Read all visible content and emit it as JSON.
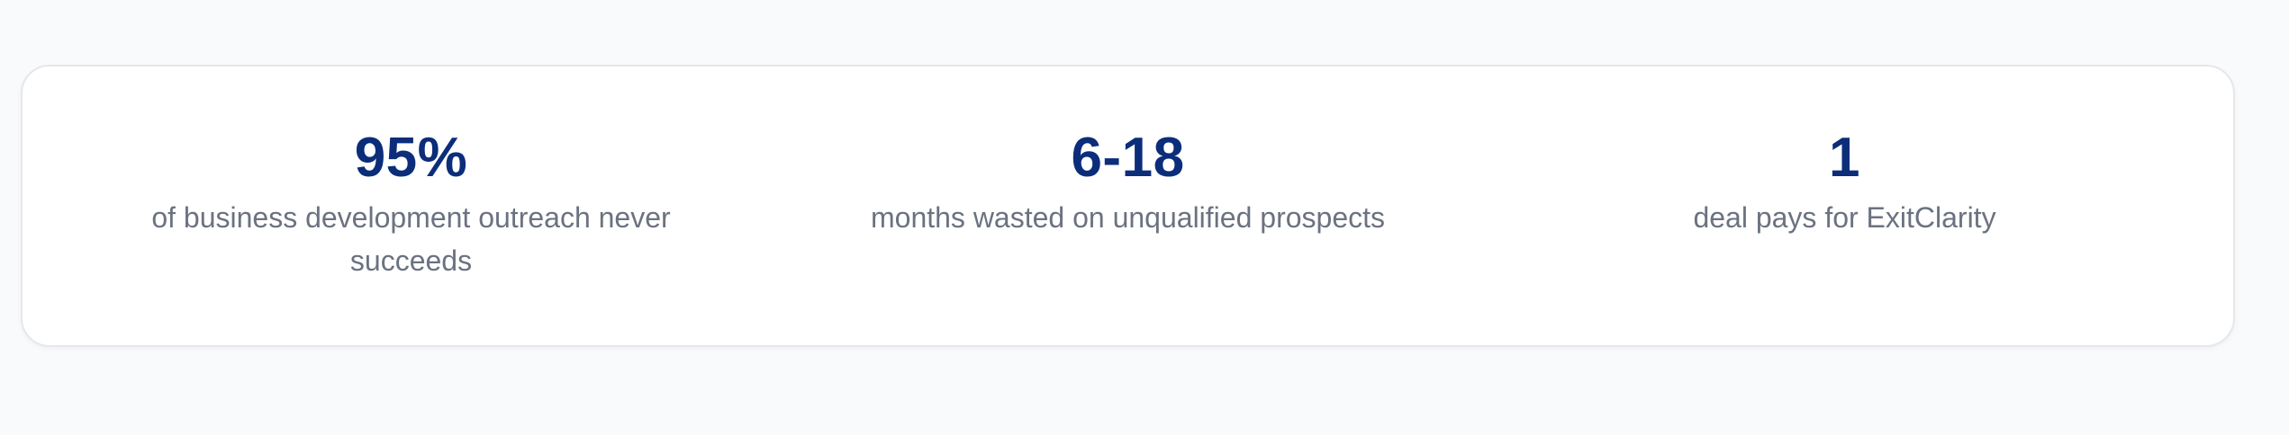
{
  "stats": [
    {
      "value": "95%",
      "label": "of business development outreach never succeeds"
    },
    {
      "value": "6-18",
      "label": "months wasted on unqualified prospects"
    },
    {
      "value": "1",
      "label": "deal pays for ExitClarity"
    }
  ],
  "colors": {
    "page_background": "#f9fafb",
    "card_background": "#ffffff",
    "value_text": "#0b2d7a",
    "label_text": "#6b7280"
  }
}
